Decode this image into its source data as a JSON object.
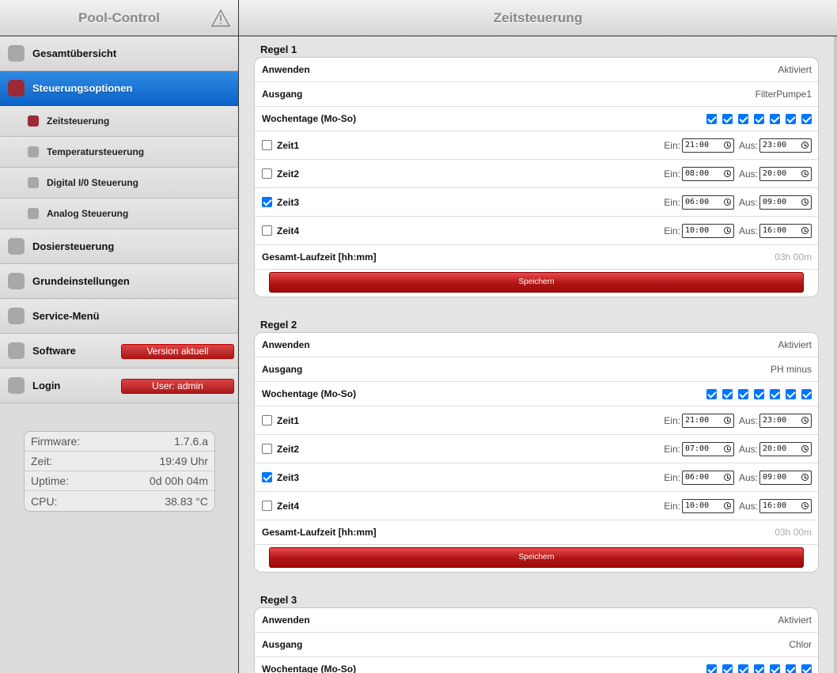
{
  "sidebar": {
    "title": "Pool-Control",
    "nav": [
      {
        "label": "Gesamtübersicht"
      },
      {
        "label": "Steuerungsoptionen"
      },
      {
        "label": "Dosiersteuerung"
      },
      {
        "label": "Grundeinstellungen"
      },
      {
        "label": "Service-Menü"
      },
      {
        "label": "Software",
        "badge": "Version aktuell"
      },
      {
        "label": "Login",
        "badge": "User: admin"
      }
    ],
    "subnav": [
      {
        "label": "Zeitsteuerung"
      },
      {
        "label": "Temperatursteuerung"
      },
      {
        "label": "Digital I/0 Steuerung"
      },
      {
        "label": "Analog Steuerung"
      }
    ],
    "info": [
      {
        "label": "Firmware:",
        "value": "1.7.6.a"
      },
      {
        "label": "Zeit:",
        "value": "19:49 Uhr"
      },
      {
        "label": "Uptime:",
        "value": "0d 00h 04m"
      },
      {
        "label": "CPU:",
        "value": "38.83 °C"
      }
    ]
  },
  "main": {
    "title": "Zeitsteuerung",
    "labels": {
      "apply": "Anwenden",
      "output": "Ausgang",
      "weekdays": "Wochentage (Mo-So)",
      "on": "Ein:",
      "off": "Aus:",
      "total": "Gesamt-Laufzeit [hh:mm]",
      "save": "Speichern"
    },
    "rules": [
      {
        "title": "Regel 1",
        "apply": "Aktiviert",
        "output": "FilterPumpe1",
        "days": [
          true,
          true,
          true,
          true,
          true,
          true,
          true
        ],
        "times": [
          {
            "label": "Zeit1",
            "checked": false,
            "on": "21:00",
            "off": "23:00"
          },
          {
            "label": "Zeit2",
            "checked": false,
            "on": "08:00",
            "off": "20:00"
          },
          {
            "label": "Zeit3",
            "checked": true,
            "on": "06:00",
            "off": "09:00"
          },
          {
            "label": "Zeit4",
            "checked": false,
            "on": "10:00",
            "off": "16:00"
          }
        ],
        "total": "03h 00m"
      },
      {
        "title": "Regel 2",
        "apply": "Aktiviert",
        "output": "PH minus",
        "days": [
          true,
          true,
          true,
          true,
          true,
          true,
          true
        ],
        "times": [
          {
            "label": "Zeit1",
            "checked": false,
            "on": "21:00",
            "off": "23:00"
          },
          {
            "label": "Zeit2",
            "checked": false,
            "on": "07:00",
            "off": "20:00"
          },
          {
            "label": "Zeit3",
            "checked": true,
            "on": "06:00",
            "off": "09:00"
          },
          {
            "label": "Zeit4",
            "checked": false,
            "on": "10:00",
            "off": "16:00"
          }
        ],
        "total": "03h 00m"
      },
      {
        "title": "Regel 3",
        "apply": "Aktiviert",
        "output": "Chlor",
        "days": [
          true,
          true,
          true,
          true,
          true,
          true,
          true
        ]
      }
    ]
  },
  "colors": {
    "accent": "#0a63c9",
    "active_marker": "#9b2a35",
    "save_button": "#b01414",
    "checkbox": "#0075ff"
  }
}
